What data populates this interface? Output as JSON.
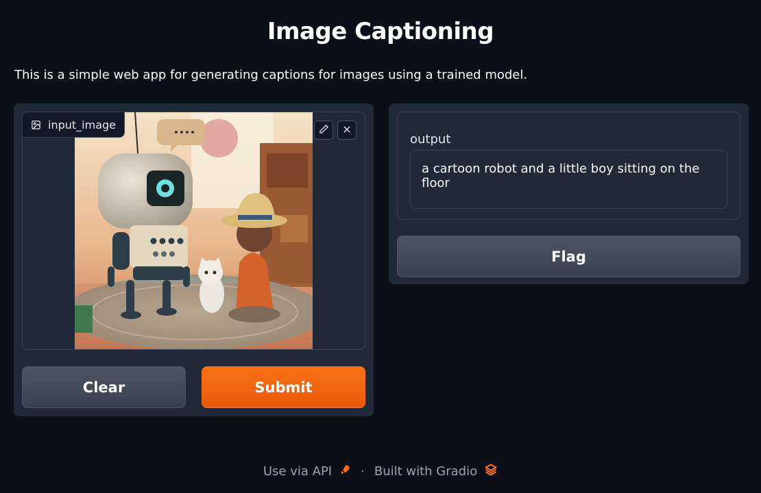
{
  "app": {
    "title": "Image Captioning",
    "description": "This is a simple web app for generating captions for images using a trained model."
  },
  "input": {
    "label": "input_image",
    "image_icon": "image-icon",
    "edit_icon": "pencil-icon",
    "close_icon": "close-icon",
    "image_alt": "cartoon robot and little boy with cat"
  },
  "buttons": {
    "clear": "Clear",
    "submit": "Submit",
    "flag": "Flag"
  },
  "output": {
    "label": "output",
    "value": "a cartoon robot and a little boy sitting on the floor"
  },
  "footer": {
    "api_label": "Use via API",
    "api_icon": "rocket-icon",
    "separator": "·",
    "built_label": "Built with Gradio",
    "gradio_icon": "gradio-logo-icon"
  },
  "colors": {
    "background": "#0b0f19",
    "panel": "#1f2937",
    "accent": "#f97316",
    "secondary_button": "#4b5563"
  }
}
